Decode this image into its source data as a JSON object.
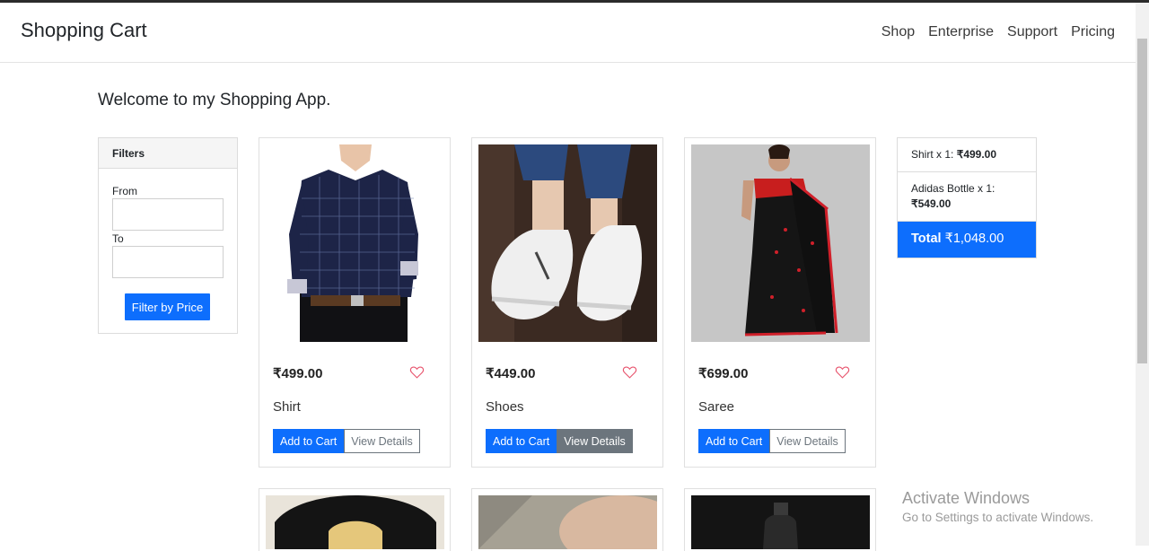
{
  "navbar": {
    "brand": "Shopping Cart",
    "links": [
      "Shop",
      "Enterprise",
      "Support",
      "Pricing"
    ]
  },
  "welcome": "Welcome to my Shopping App.",
  "filters": {
    "title": "Filters",
    "from_label": "From",
    "from_value": "",
    "to_label": "To",
    "to_value": "",
    "button": "Filter by Price"
  },
  "products": [
    {
      "name": "Shirt",
      "price": "₹499.00",
      "add_label": "Add to Cart",
      "view_label": "View Details"
    },
    {
      "name": "Shoes",
      "price": "₹449.00",
      "add_label": "Add to Cart",
      "view_label": "View Details"
    },
    {
      "name": "Saree",
      "price": "₹699.00",
      "add_label": "Add to Cart",
      "view_label": "View Details"
    }
  ],
  "cart": {
    "items": [
      {
        "label": "Shirt x 1: ",
        "amount": "₹499.00"
      },
      {
        "label": "Adidas Bottle x 1: ",
        "amount": "₹549.00"
      }
    ],
    "total_label": "Total",
    "total_value": "₹1,048.00"
  },
  "activate_windows": {
    "title": "Activate Windows",
    "subtitle": "Go to Settings to activate Windows."
  },
  "colors": {
    "primary": "#0d6efd",
    "secondary": "#6c757d",
    "heart": "#e8566f"
  }
}
